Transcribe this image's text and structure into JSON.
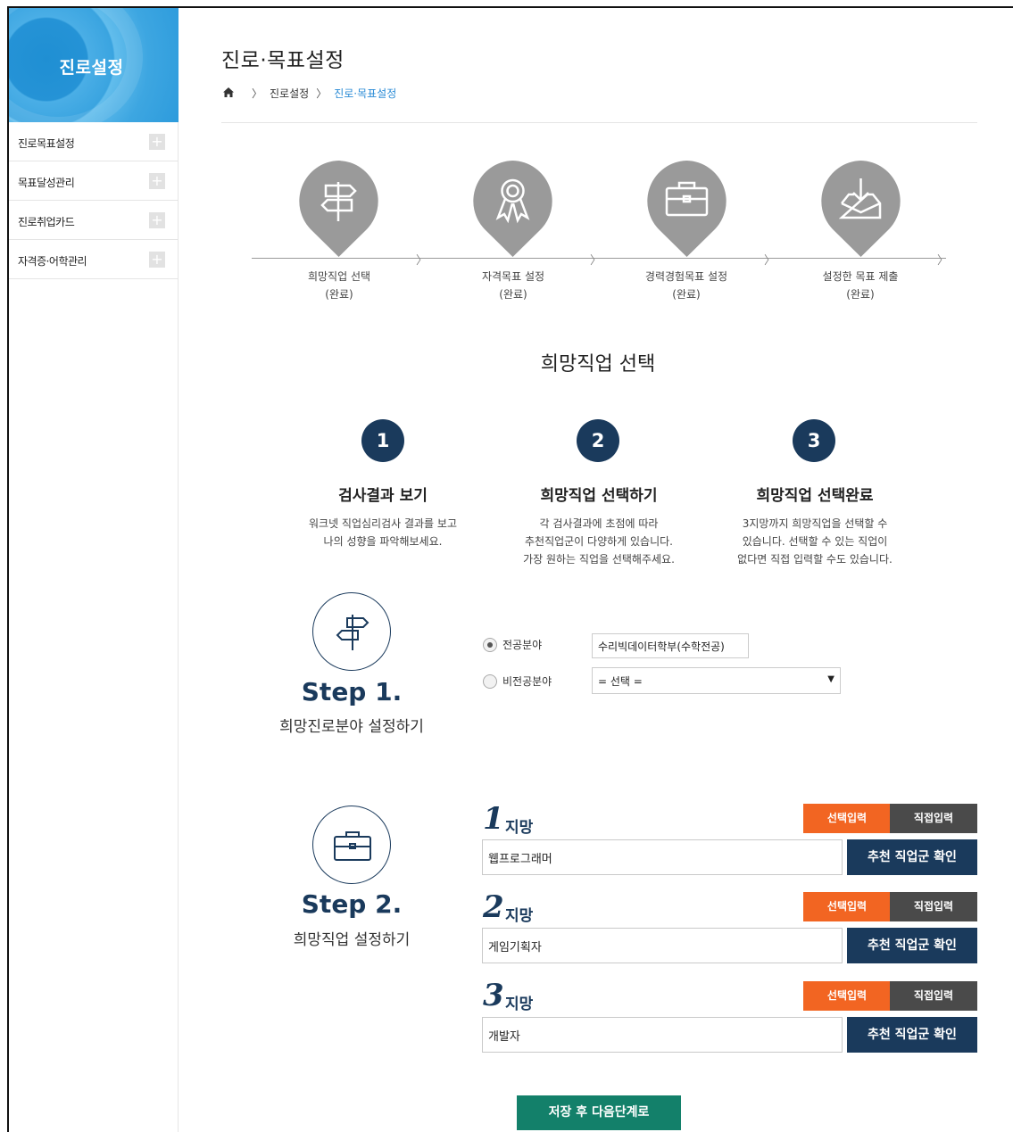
{
  "sidebar": {
    "title": "진로설정",
    "items": [
      {
        "label": "진로목표설정"
      },
      {
        "label": "목표달성관리"
      },
      {
        "label": "진로취업카드"
      },
      {
        "label": "자격증·어학관리"
      }
    ]
  },
  "header": {
    "title": "진로·목표설정",
    "breadcrumb": [
      "진로설정",
      "진로·목표설정"
    ]
  },
  "progress": [
    {
      "label": "희망직업 선택",
      "status": "(완료)",
      "icon": "signpost-icon"
    },
    {
      "label": "자격목표 설정",
      "status": "(완료)",
      "icon": "award-ribbon-icon"
    },
    {
      "label": "경력경험목표 설정",
      "status": "(완료)",
      "icon": "briefcase-icon"
    },
    {
      "label": "설정한 목표 제출",
      "status": "(완료)",
      "icon": "inbox-download-icon"
    }
  ],
  "section_title": "희망직업 선택",
  "guide": [
    {
      "num": "1",
      "title": "검사결과 보기",
      "desc": [
        "워크넷 직업심리검사 결과를 보고",
        "나의 성향을 파악해보세요."
      ]
    },
    {
      "num": "2",
      "title": "희망직업 선택하기",
      "desc": [
        "각 검사결과에 초점에 따라",
        "추천직업군이 다양하게 있습니다.",
        "가장 원하는 직업을 선택해주세요."
      ]
    },
    {
      "num": "3",
      "title": "희망직업 선택완료",
      "desc": [
        "3지망까지 희망직업을 선택할 수",
        "있습니다. 선택할 수 있는 직업이",
        "없다면 직접 입력할 수도 있습니다."
      ]
    }
  ],
  "step1": {
    "head": "Step 1.",
    "sub": "희망진로분야 설정하기",
    "major_label": "전공분야",
    "major_value": "수리빅데이터학부(수학전공)",
    "nonmajor_label": "비전공분야",
    "nonmajor_select": "= 선택 ="
  },
  "step2": {
    "head": "Step 2.",
    "sub": "희망직업 설정하기",
    "choice_word": "지망",
    "select_tab": "선택입력",
    "direct_tab": "직접입력",
    "rec_button": "추천 직업군 확인",
    "choices": [
      {
        "num": "1",
        "value": "웹프로그래머"
      },
      {
        "num": "2",
        "value": "게임기획자"
      },
      {
        "num": "3",
        "value": "개발자"
      }
    ]
  },
  "save_button": "저장 후 다음단계로",
  "colors": {
    "navy": "#1a3a5c",
    "orange": "#f26522",
    "dark_tab": "#4a4a4a",
    "green": "#13806a",
    "sidebar_blue": "#2d9bdc",
    "pin_gray": "#9a9a9a"
  }
}
